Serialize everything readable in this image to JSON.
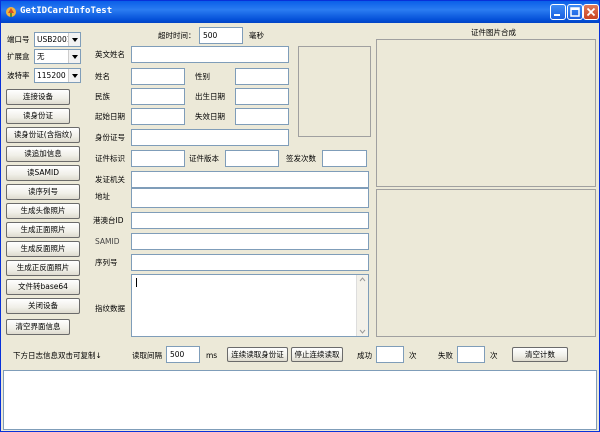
{
  "window": {
    "title": "GetIDCardInfoTest"
  },
  "settings": {
    "port_label": "端口号",
    "port_value": "USB2001",
    "ext_label": "扩展盒",
    "ext_value": "无",
    "baud_label": "波特率",
    "baud_value": "115200",
    "timeout_label": "超时时间：",
    "timeout_value": "500",
    "timeout_unit": "毫秒"
  },
  "buttons": [
    "连接设备",
    "读身份证",
    "读身份证(含指纹)",
    "读追加信息",
    "读SAMID",
    "读序列号",
    "生成头像照片",
    "生成正面照片",
    "生成反面照片",
    "生成正反面照片",
    "文件转base64",
    "关闭设备",
    "清空界面信息"
  ],
  "fields": {
    "english_name": "英文姓名",
    "name": "姓名",
    "gender": "性别",
    "ethnicity": "民族",
    "birth_date": "出生日期",
    "start_date": "起始日期",
    "expire_date": "失效日期",
    "id_number": "身份证号",
    "cert_flag": "证件标识",
    "cert_version": "证件版本",
    "issue_count": "签发次数",
    "issuing_authority": "发证机关",
    "address": "地址",
    "hk_taiwan_id": "港澳台ID",
    "samid": "SAMID",
    "serial_no": "序列号",
    "fingerprint": "指纹数据"
  },
  "photo_panel": {
    "title": "证件图片合成"
  },
  "bottom": {
    "log_hint": "下方日志信息双击可复制↓",
    "interval_label": "读取间隔",
    "interval_value": "500",
    "interval_unit": "ms",
    "continuous_btn": "连续读取身份证",
    "stop_btn": "停止连续读取",
    "success_label": "成功",
    "success_unit": "次",
    "fail_label": "失败",
    "fail_unit": "次",
    "clear_count_btn": "清空计数"
  },
  "colors": {
    "title_bar": "#0a5fe8",
    "window_bg": "#ece9d8",
    "input_border": "#7f9db9"
  }
}
